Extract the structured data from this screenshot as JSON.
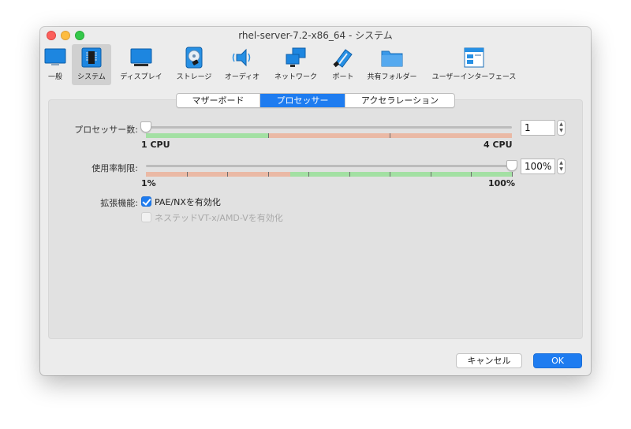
{
  "window": {
    "title": "rhel-server-7.2-x86_64 - システム"
  },
  "toolbar": {
    "items": [
      {
        "label": "一般",
        "icon": "monitor-icon"
      },
      {
        "label": "システム",
        "icon": "chip-icon"
      },
      {
        "label": "ディスプレイ",
        "icon": "display-icon"
      },
      {
        "label": "ストレージ",
        "icon": "disk-icon"
      },
      {
        "label": "オーディオ",
        "icon": "speaker-icon"
      },
      {
        "label": "ネットワーク",
        "icon": "network-icon"
      },
      {
        "label": "ポート",
        "icon": "port-icon"
      },
      {
        "label": "共有フォルダー",
        "icon": "folder-icon"
      },
      {
        "label": "ユーザーインターフェース",
        "icon": "ui-window-icon"
      }
    ],
    "selected": "システム"
  },
  "tabs": {
    "items": [
      "マザーボード",
      "プロセッサー",
      "アクセラレーション"
    ],
    "active": "プロセッサー"
  },
  "processor": {
    "count_label": "プロセッサー数:",
    "count_value": "1",
    "count_min_label": "1 CPU",
    "count_max_label": "4 CPU",
    "count_min": 1,
    "count_max": 4,
    "count_current": 1,
    "count_green_until": 2,
    "cap_label": "使用率制限:",
    "cap_value": "100%",
    "cap_min_label": "1%",
    "cap_max_label": "100%",
    "cap_current_percent": 100,
    "cap_red_until_percent": 40
  },
  "extended": {
    "label": "拡張機能:",
    "pae_label": "PAE/NXを有効化",
    "pae_checked": true,
    "nested_label": "ネステッドVT-x/AMD-Vを有効化",
    "nested_checked": false,
    "nested_enabled": false
  },
  "buttons": {
    "cancel": "キャンセル",
    "ok": "OK"
  },
  "colors": {
    "accent": "#1e7cf0",
    "green_zone": "#a3e0a3",
    "red_zone": "#eab9a5"
  }
}
